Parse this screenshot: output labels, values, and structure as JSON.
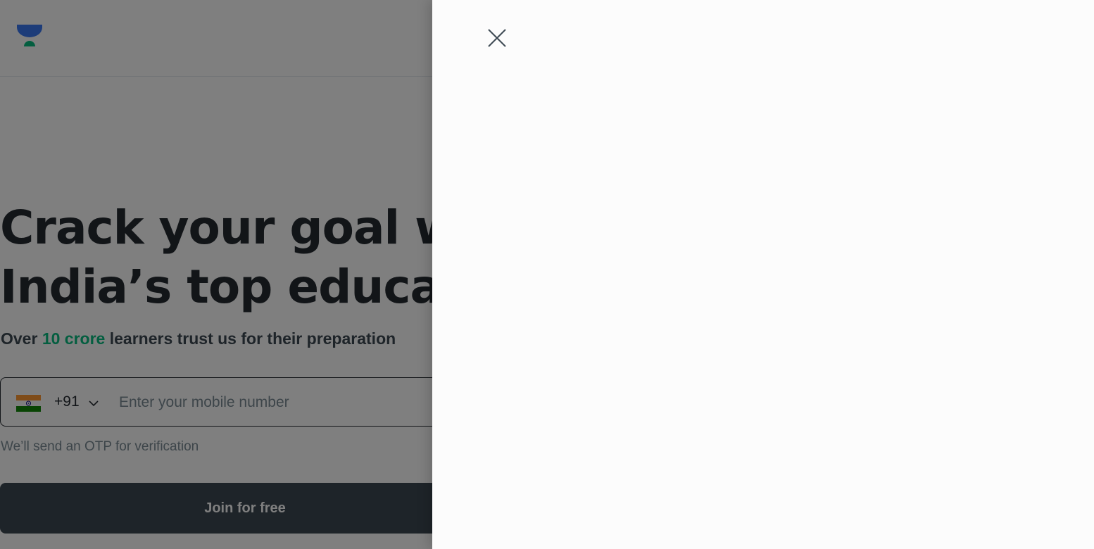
{
  "hero": {
    "title_line1": "Crack your goal with",
    "title_line2": "India’s top educators",
    "subtitle_before": "Over ",
    "subtitle_highlight": "10 crore",
    "subtitle_after": " learners trust us for their preparation"
  },
  "phone": {
    "country_code": "+91",
    "placeholder": "Enter your mobile number",
    "value": ""
  },
  "otp_note": "We’ll send an OTP for verification",
  "join_button": "Join for free",
  "icons": {
    "logo": "brand-logo-icon",
    "flag": "india-flag-icon",
    "chevron": "chevron-down-icon",
    "close": "close-icon"
  },
  "colors": {
    "text_dark": "#252a31",
    "accent_green": "#08bd80",
    "logo_blue": "#3a79f3",
    "logo_green": "#08bd80",
    "button_bg": "#3c4852",
    "overlay": "rgba(0,0,0,0.5)",
    "drawer_bg": "#fcfcfc"
  }
}
